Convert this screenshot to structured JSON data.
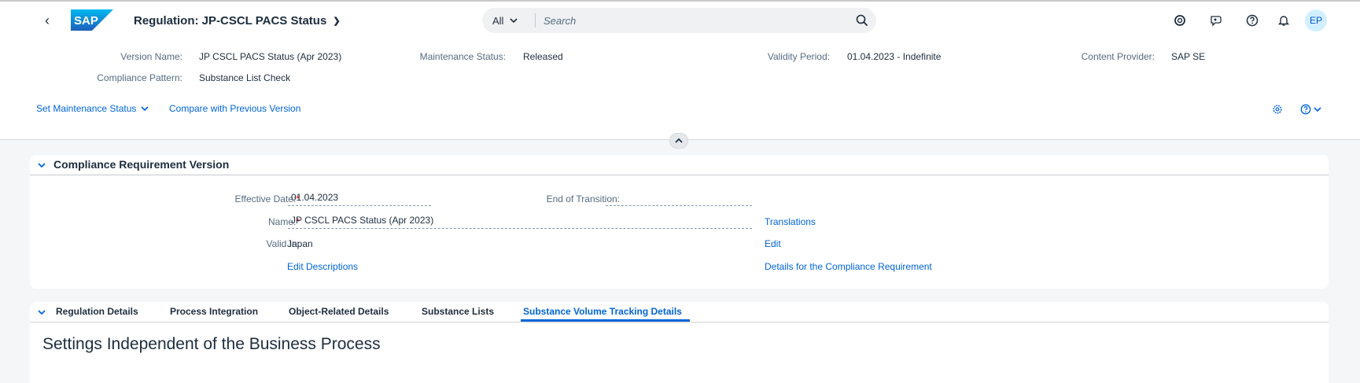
{
  "shell": {
    "app_title": "Regulation: JP-CSCL PACS Status",
    "search_scope": "All",
    "search_placeholder": "Search",
    "avatar_initials": "EP",
    "logo_text": "SAP"
  },
  "header": {
    "fields": {
      "version_name_label": "Version Name:",
      "version_name_value": "JP CSCL PACS Status (Apr 2023)",
      "maintenance_status_label": "Maintenance Status:",
      "maintenance_status_value": "Released",
      "validity_period_label": "Validity Period:",
      "validity_period_value": "01.04.2023 - Indefinite",
      "content_provider_label": "Content Provider:",
      "content_provider_value": "SAP SE",
      "compliance_pattern_label": "Compliance Pattern:",
      "compliance_pattern_value": "Substance List Check"
    },
    "actions": {
      "set_maintenance_status": "Set Maintenance Status",
      "compare_previous": "Compare with Previous Version"
    }
  },
  "section": {
    "title": "Compliance Requirement Version",
    "effective_date_label": "Effective Date:",
    "effective_date_value": "01.04.2023",
    "end_of_transition_label": "End of Transition:",
    "end_of_transition_value": "",
    "name_label": "Name:",
    "name_value": "JP CSCL PACS Status (Apr 2023)",
    "valid_in_label": "Valid In:",
    "valid_in_value": "Japan",
    "required_marker": "*",
    "links": {
      "translations": "Translations",
      "edit": "Edit",
      "edit_descriptions": "Edit Descriptions",
      "details": "Details for the Compliance Requirement"
    }
  },
  "tabs": [
    {
      "label": "Regulation Details",
      "active": false
    },
    {
      "label": "Process Integration",
      "active": false
    },
    {
      "label": "Object-Related Details",
      "active": false
    },
    {
      "label": "Substance Lists",
      "active": false
    },
    {
      "label": "Substance Volume Tracking Details",
      "active": true
    }
  ],
  "content": {
    "heading": "Settings Independent of the Business Process"
  },
  "colors": {
    "brand_blue": "#0064d9",
    "text": "#1d2d3e",
    "label": "#556b82",
    "required": "#ee0000"
  },
  "icons": {
    "back": "back-arrow-icon",
    "search": "search-icon",
    "shell_icons": [
      "copilot-icon",
      "feedback-icon",
      "help-icon",
      "notification-bell-icon"
    ],
    "header_tools": [
      "settings-gear-icon",
      "help-icon"
    ]
  }
}
